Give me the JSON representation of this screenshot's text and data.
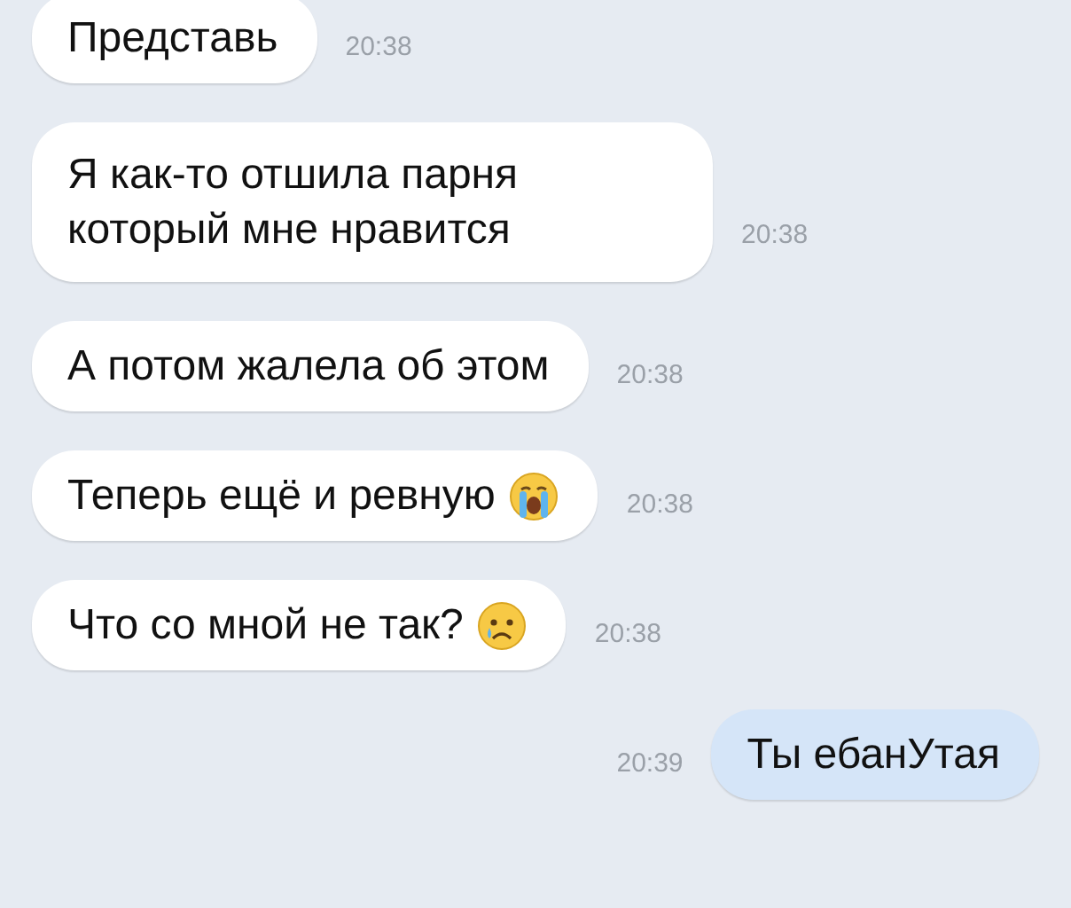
{
  "messages": [
    {
      "kind": "incoming",
      "lines": [
        "Представь"
      ],
      "time": "20:38"
    },
    {
      "kind": "incoming",
      "lines": [
        "Я как-то отшила парня",
        "который мне нравится"
      ],
      "time": "20:38"
    },
    {
      "kind": "incoming",
      "lines": [
        "А потом жалела об этом"
      ],
      "time": "20:38"
    },
    {
      "kind": "incoming",
      "lines": [
        "Теперь ещё и ревную"
      ],
      "emoji": {
        "kind": "sobbing"
      },
      "time": "20:38"
    },
    {
      "kind": "incoming",
      "lines": [
        "Что со мной не так?"
      ],
      "emoji": {
        "kind": "tear"
      },
      "time": "20:38"
    },
    {
      "kind": "outgoing",
      "lines": [
        "Ты ебанУтая"
      ],
      "time": "20:39"
    }
  ]
}
